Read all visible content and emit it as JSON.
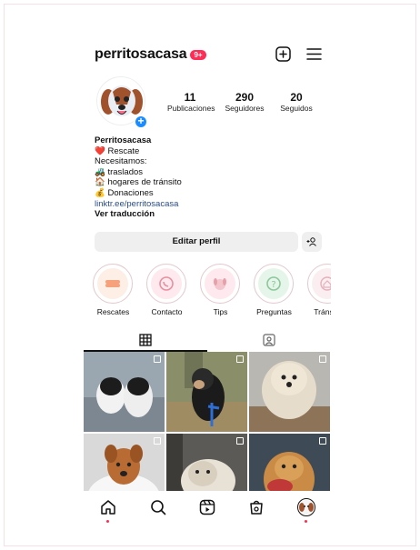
{
  "profile": {
    "username": "perritosacasa",
    "notifications_badge": "9+",
    "stats": {
      "posts": "11",
      "posts_label": "Publicaciones",
      "followers": "290",
      "followers_label": "Seguidores",
      "following": "20",
      "following_label": "Seguidos"
    },
    "bio": {
      "name": "Perritosacasa",
      "line1": "❤️ Rescate",
      "line2": "Necesitamos:",
      "line3": "🚜 traslados",
      "line4": "🏠 hogares de tránsito",
      "line5": "💰 Donaciones",
      "link": "linktr.ee/perritosacasa",
      "translate": "Ver traducción"
    },
    "edit_label": "Editar perfil"
  },
  "highlights": [
    {
      "label": "Rescates",
      "icon": "bone-icon",
      "color": "#f6a07c"
    },
    {
      "label": "Contacto",
      "icon": "whatsapp-icon",
      "color": "#e88fa0"
    },
    {
      "label": "Tips",
      "icon": "dog-icon",
      "color": "#e8a0a8"
    },
    {
      "label": "Preguntas",
      "icon": "question-icon",
      "color": "#8cc79a"
    },
    {
      "label": "Tránsito",
      "icon": "home-icon",
      "color": "#e4b1bc"
    }
  ],
  "colors": {
    "badge": "#ff2c55",
    "link": "#2a4c8a",
    "button_bg": "#efefef",
    "avatar_plus": "#1a8cff"
  },
  "tabs": [
    "grid-icon",
    "tagged-icon"
  ],
  "bottom_nav": [
    "home-icon",
    "search-icon",
    "reels-icon",
    "shop-icon",
    "profile-avatar"
  ]
}
